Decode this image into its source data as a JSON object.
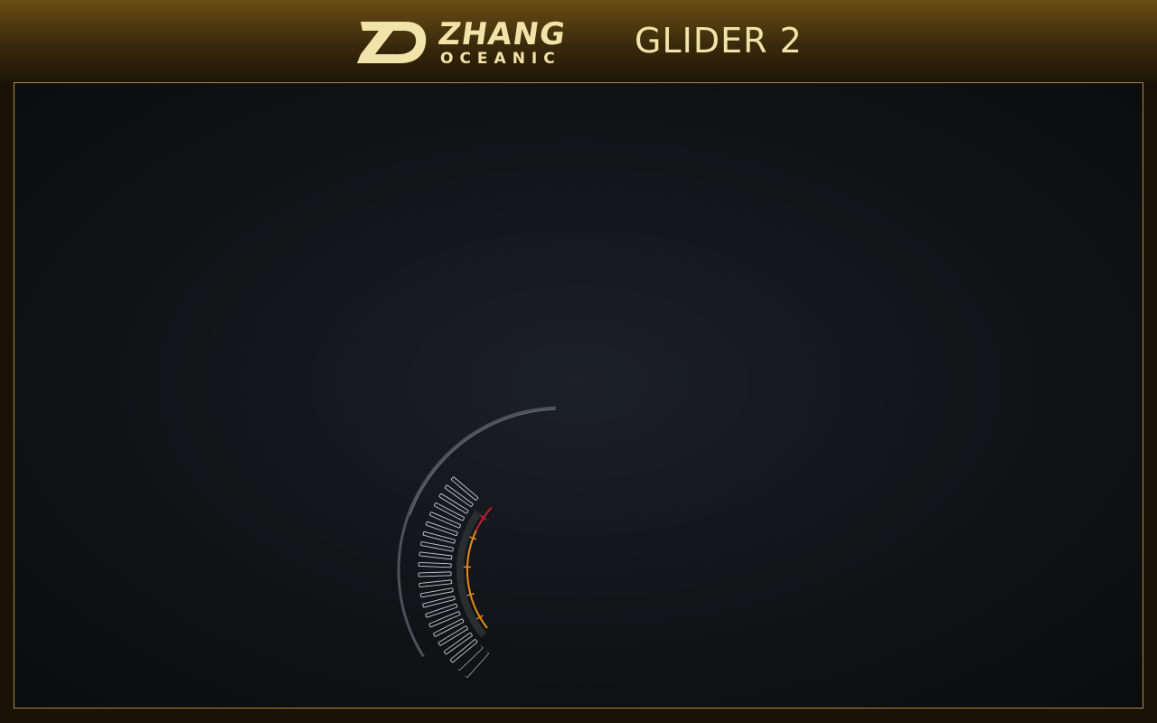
{
  "header": {
    "brand_name": "ZHANG",
    "brand_sub": "OCEANIC",
    "logo": "zd-monogram-logo",
    "product_title": "GLIDER 2"
  },
  "colors": {
    "accent_gold": "#f3e3a8",
    "frame_border": "#b08a3c",
    "gauge_orange": "#e88a1a",
    "gauge_red": "#c21f2e",
    "gauge_grey": "#8a8f94"
  },
  "gauge": {
    "type": "partial-circular-dial"
  }
}
